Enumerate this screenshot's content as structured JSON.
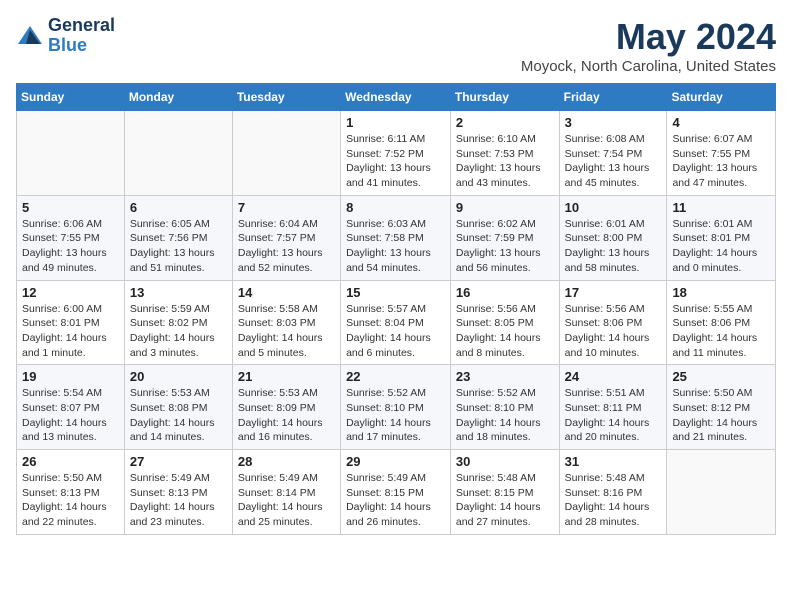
{
  "header": {
    "logo_line1": "General",
    "logo_line2": "Blue",
    "month": "May 2024",
    "location": "Moyock, North Carolina, United States"
  },
  "weekdays": [
    "Sunday",
    "Monday",
    "Tuesday",
    "Wednesday",
    "Thursday",
    "Friday",
    "Saturday"
  ],
  "weeks": [
    [
      {
        "day": "",
        "info": ""
      },
      {
        "day": "",
        "info": ""
      },
      {
        "day": "",
        "info": ""
      },
      {
        "day": "1",
        "info": "Sunrise: 6:11 AM\nSunset: 7:52 PM\nDaylight: 13 hours\nand 41 minutes."
      },
      {
        "day": "2",
        "info": "Sunrise: 6:10 AM\nSunset: 7:53 PM\nDaylight: 13 hours\nand 43 minutes."
      },
      {
        "day": "3",
        "info": "Sunrise: 6:08 AM\nSunset: 7:54 PM\nDaylight: 13 hours\nand 45 minutes."
      },
      {
        "day": "4",
        "info": "Sunrise: 6:07 AM\nSunset: 7:55 PM\nDaylight: 13 hours\nand 47 minutes."
      }
    ],
    [
      {
        "day": "5",
        "info": "Sunrise: 6:06 AM\nSunset: 7:55 PM\nDaylight: 13 hours\nand 49 minutes."
      },
      {
        "day": "6",
        "info": "Sunrise: 6:05 AM\nSunset: 7:56 PM\nDaylight: 13 hours\nand 51 minutes."
      },
      {
        "day": "7",
        "info": "Sunrise: 6:04 AM\nSunset: 7:57 PM\nDaylight: 13 hours\nand 52 minutes."
      },
      {
        "day": "8",
        "info": "Sunrise: 6:03 AM\nSunset: 7:58 PM\nDaylight: 13 hours\nand 54 minutes."
      },
      {
        "day": "9",
        "info": "Sunrise: 6:02 AM\nSunset: 7:59 PM\nDaylight: 13 hours\nand 56 minutes."
      },
      {
        "day": "10",
        "info": "Sunrise: 6:01 AM\nSunset: 8:00 PM\nDaylight: 13 hours\nand 58 minutes."
      },
      {
        "day": "11",
        "info": "Sunrise: 6:01 AM\nSunset: 8:01 PM\nDaylight: 14 hours\nand 0 minutes."
      }
    ],
    [
      {
        "day": "12",
        "info": "Sunrise: 6:00 AM\nSunset: 8:01 PM\nDaylight: 14 hours\nand 1 minute."
      },
      {
        "day": "13",
        "info": "Sunrise: 5:59 AM\nSunset: 8:02 PM\nDaylight: 14 hours\nand 3 minutes."
      },
      {
        "day": "14",
        "info": "Sunrise: 5:58 AM\nSunset: 8:03 PM\nDaylight: 14 hours\nand 5 minutes."
      },
      {
        "day": "15",
        "info": "Sunrise: 5:57 AM\nSunset: 8:04 PM\nDaylight: 14 hours\nand 6 minutes."
      },
      {
        "day": "16",
        "info": "Sunrise: 5:56 AM\nSunset: 8:05 PM\nDaylight: 14 hours\nand 8 minutes."
      },
      {
        "day": "17",
        "info": "Sunrise: 5:56 AM\nSunset: 8:06 PM\nDaylight: 14 hours\nand 10 minutes."
      },
      {
        "day": "18",
        "info": "Sunrise: 5:55 AM\nSunset: 8:06 PM\nDaylight: 14 hours\nand 11 minutes."
      }
    ],
    [
      {
        "day": "19",
        "info": "Sunrise: 5:54 AM\nSunset: 8:07 PM\nDaylight: 14 hours\nand 13 minutes."
      },
      {
        "day": "20",
        "info": "Sunrise: 5:53 AM\nSunset: 8:08 PM\nDaylight: 14 hours\nand 14 minutes."
      },
      {
        "day": "21",
        "info": "Sunrise: 5:53 AM\nSunset: 8:09 PM\nDaylight: 14 hours\nand 16 minutes."
      },
      {
        "day": "22",
        "info": "Sunrise: 5:52 AM\nSunset: 8:10 PM\nDaylight: 14 hours\nand 17 minutes."
      },
      {
        "day": "23",
        "info": "Sunrise: 5:52 AM\nSunset: 8:10 PM\nDaylight: 14 hours\nand 18 minutes."
      },
      {
        "day": "24",
        "info": "Sunrise: 5:51 AM\nSunset: 8:11 PM\nDaylight: 14 hours\nand 20 minutes."
      },
      {
        "day": "25",
        "info": "Sunrise: 5:50 AM\nSunset: 8:12 PM\nDaylight: 14 hours\nand 21 minutes."
      }
    ],
    [
      {
        "day": "26",
        "info": "Sunrise: 5:50 AM\nSunset: 8:13 PM\nDaylight: 14 hours\nand 22 minutes."
      },
      {
        "day": "27",
        "info": "Sunrise: 5:49 AM\nSunset: 8:13 PM\nDaylight: 14 hours\nand 23 minutes."
      },
      {
        "day": "28",
        "info": "Sunrise: 5:49 AM\nSunset: 8:14 PM\nDaylight: 14 hours\nand 25 minutes."
      },
      {
        "day": "29",
        "info": "Sunrise: 5:49 AM\nSunset: 8:15 PM\nDaylight: 14 hours\nand 26 minutes."
      },
      {
        "day": "30",
        "info": "Sunrise: 5:48 AM\nSunset: 8:15 PM\nDaylight: 14 hours\nand 27 minutes."
      },
      {
        "day": "31",
        "info": "Sunrise: 5:48 AM\nSunset: 8:16 PM\nDaylight: 14 hours\nand 28 minutes."
      },
      {
        "day": "",
        "info": ""
      }
    ]
  ]
}
